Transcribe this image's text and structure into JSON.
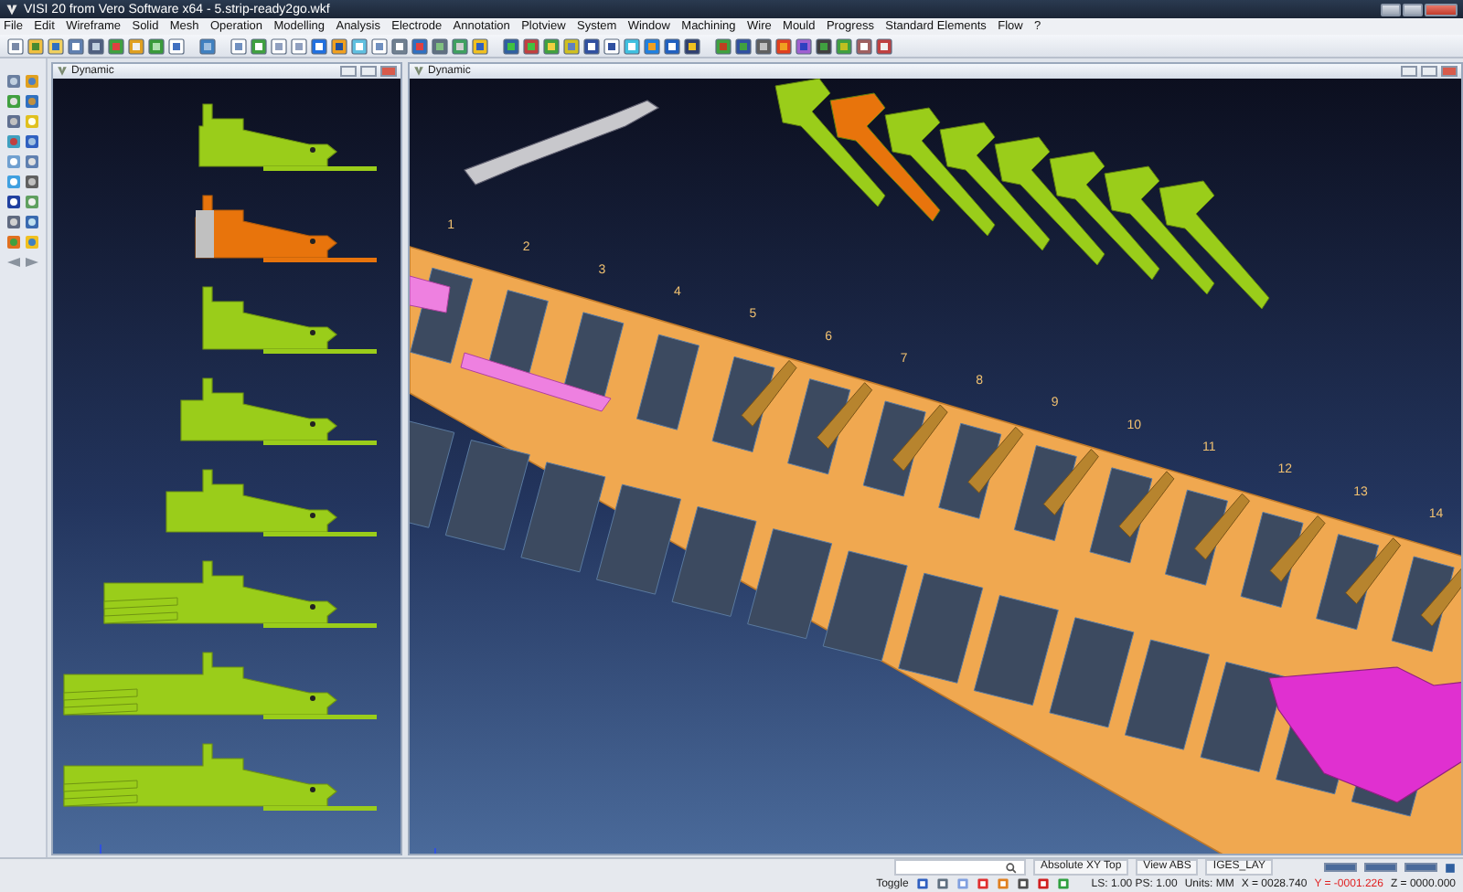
{
  "window": {
    "title": "VISI 20 from Vero Software x64 - 5.strip-ready2go.wkf"
  },
  "menu": [
    "File",
    "Edit",
    "Wireframe",
    "Solid",
    "Mesh",
    "Operation",
    "Modelling",
    "Analysis",
    "Electrode",
    "Annotation",
    "Plotview",
    "System",
    "Window",
    "Machining",
    "Wire",
    "Mould",
    "Progress",
    "Standard Elements",
    "Flow",
    "?"
  ],
  "viewports": [
    {
      "title": "Dynamic",
      "kind": "parts"
    },
    {
      "title": "Dynamic",
      "kind": "strip",
      "station_numbers": [
        "1",
        "2",
        "3",
        "4",
        "5",
        "6",
        "7",
        "8",
        "9",
        "10",
        "11",
        "12",
        "13",
        "14"
      ]
    }
  ],
  "status_bar": {
    "fields": [
      "Absolute XY Top",
      "View ABS",
      "IGES_LAY"
    ],
    "toggle": "Toggle",
    "scale": "LS: 1.00 PS: 1.00",
    "units": "Units: MM",
    "coordinates": [
      {
        "text": "X = 0028.740",
        "color": "#1a1a1a"
      },
      {
        "text": "Y = -0001.226",
        "color": "#e02020"
      },
      {
        "text": "Z = 0000.000",
        "color": "#1a1a1a"
      }
    ]
  }
}
